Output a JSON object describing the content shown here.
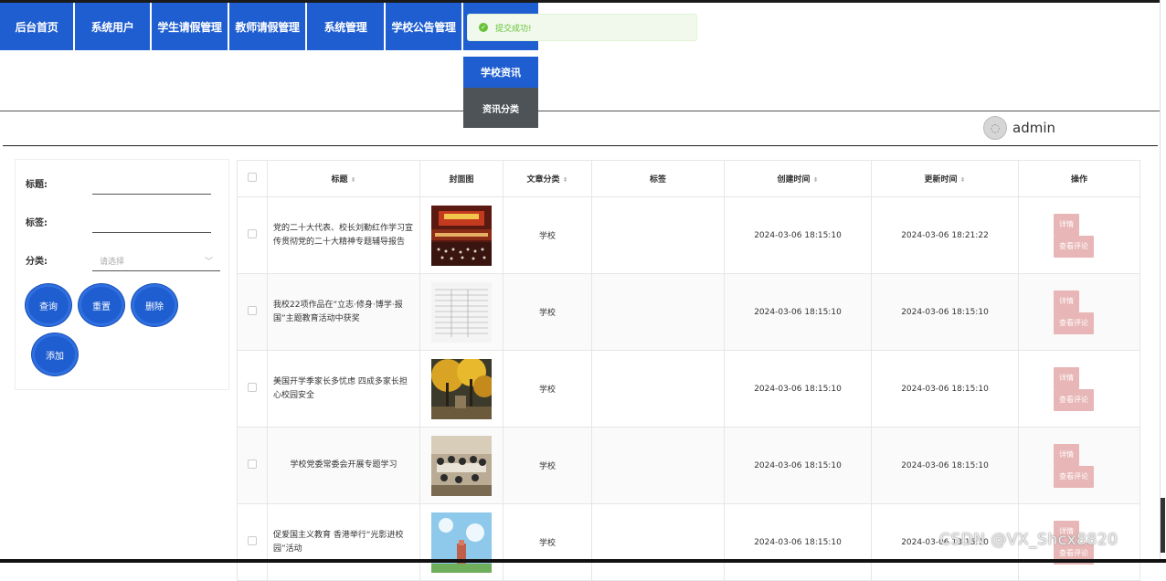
{
  "nav": {
    "items": [
      "后台首页",
      "系统用户",
      "学生请假管理",
      "教师请假管理",
      "系统管理",
      "学校公告管理",
      ""
    ]
  },
  "dropdown": {
    "items": [
      "学校资讯",
      "资讯分类"
    ]
  },
  "toast": {
    "message": "提交成功!"
  },
  "user": {
    "name": "admin"
  },
  "filters": {
    "title_label": "标题:",
    "tag_label": "标签:",
    "category_label": "分类:",
    "category_placeholder": "请选择",
    "buttons": {
      "query": "查询",
      "reset": "重置",
      "delete": "删除",
      "add": "添加"
    }
  },
  "table": {
    "headers": [
      "",
      "标题",
      "封面图",
      "文章分类",
      "标签",
      "创建时间",
      "更新时间",
      "操作"
    ],
    "rows": [
      {
        "title": "党的二十大代表、校长刘勤红作学习宣传贯彻党的二十大精神专题辅导报告",
        "category": "学校",
        "tag": "",
        "created": "2024-03-06 18:15:10",
        "updated": "2024-03-06 18:21:22"
      },
      {
        "title": "我校22项作品在“立志·修身·博学·报国”主题教育活动中获奖",
        "category": "学校",
        "tag": "",
        "created": "2024-03-06 18:15:10",
        "updated": "2024-03-06 18:15:10"
      },
      {
        "title": "美国开学季家长多忧虑 四成多家长担心校园安全",
        "category": "学校",
        "tag": "",
        "created": "2024-03-06 18:15:10",
        "updated": "2024-03-06 18:15:10"
      },
      {
        "title": "学校党委常委会开展专题学习",
        "category": "学校",
        "tag": "",
        "created": "2024-03-06 18:15:10",
        "updated": "2024-03-06 18:15:10"
      },
      {
        "title": "促爱国主义教育 香港举行“光影进校园”活动",
        "category": "学校",
        "tag": "",
        "created": "2024-03-06 18:15:10",
        "updated": "2024-03-06 18:15:10"
      }
    ],
    "actions": {
      "detail": "详情",
      "comments": "查看评论"
    }
  },
  "watermark": "CSDN @VX_Shcx8820",
  "colors": {
    "primary": "#1f5ed0",
    "menu_dark": "#4d5356",
    "success": "#67c23a",
    "action_btn": "#e8b6b6"
  }
}
